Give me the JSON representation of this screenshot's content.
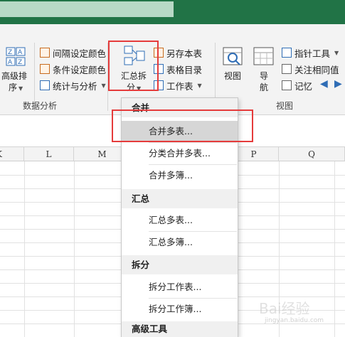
{
  "ribbon": {
    "sort_button": {
      "line1": "高级排",
      "line2": "序",
      "icon": "sort-az-icon"
    },
    "data_analysis": {
      "items": [
        {
          "label": "间隔设定颜色",
          "icon": "interval-color-icon"
        },
        {
          "label": "条件设定颜色",
          "icon": "condition-color-icon"
        },
        {
          "label": "统计与分析",
          "icon": "statistics-icon"
        }
      ],
      "group_label": "数据分析"
    },
    "summarize_split": {
      "line1": "汇总拆",
      "line2": "分",
      "icon": "summarize-split-icon"
    },
    "worksheet_group": {
      "items": [
        {
          "label": "另存本表",
          "icon": "save-sheet-icon"
        },
        {
          "label": "表格目录",
          "icon": "table-directory-icon"
        },
        {
          "label": "工作表",
          "icon": "worksheet-icon"
        }
      ]
    },
    "view_group": {
      "view_button": "视图",
      "nav_button": {
        "line1": "导",
        "line2": "航"
      },
      "items": [
        {
          "label": "指针工具",
          "icon": "pointer-tool-icon"
        },
        {
          "label": "关注相同值",
          "icon": "focus-same-icon"
        },
        {
          "label": "记忆",
          "icon": "memory-icon"
        }
      ],
      "group_label": "视图"
    }
  },
  "grid": {
    "columns": [
      {
        "label": "K"
      },
      {
        "label": "L"
      },
      {
        "label": "M"
      },
      {
        "label": "P"
      },
      {
        "label": "Q"
      }
    ]
  },
  "dropdown": {
    "sections": [
      {
        "header": "合并",
        "items": [
          "合并多表...",
          "分类合并多表...",
          "合并多簿..."
        ]
      },
      {
        "header": "汇总",
        "items": [
          "汇总多表...",
          "汇总多簿..."
        ]
      },
      {
        "header": "拆分",
        "items": [
          "拆分工作表...",
          "拆分工作簿..."
        ]
      },
      {
        "header": "高级工具",
        "items": []
      }
    ],
    "highlighted_item": "合并多表..."
  },
  "watermark": {
    "text": "Bai经验",
    "sub": "jingyan.baidu.com"
  },
  "colors": {
    "title_bar": "#217346",
    "highlight_box": "#e53b3b",
    "menu_highlight": "#d6d6d6"
  }
}
